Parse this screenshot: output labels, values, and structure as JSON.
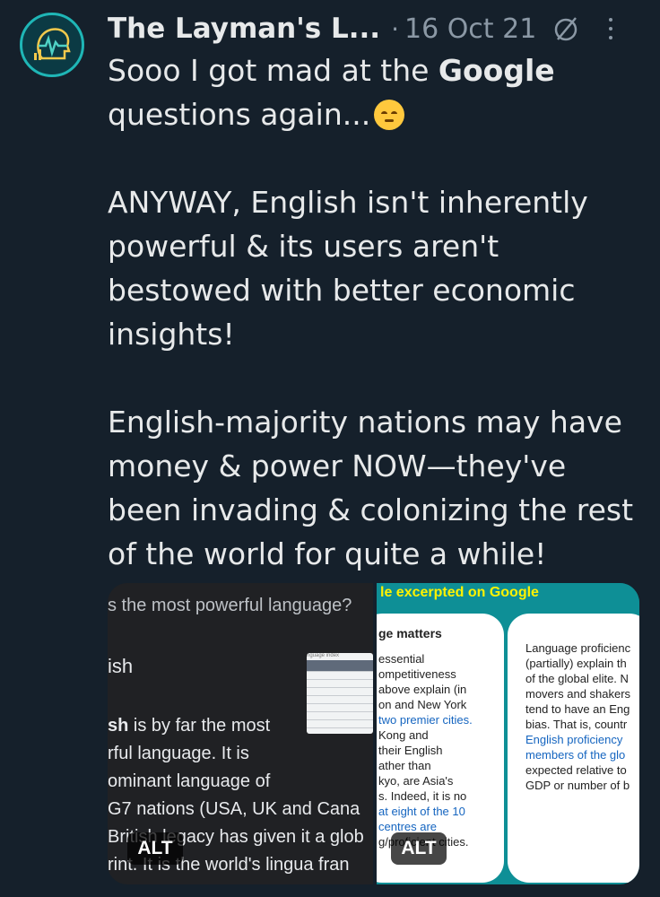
{
  "tweet": {
    "display_name": "The Layman's L...",
    "separator": "·",
    "date": "16 Oct 21",
    "lines_p1": [
      "Sooo I got mad at the "
    ],
    "bold_word": "Google",
    "line_p1b": "questions again...",
    "para2": [
      "ANYWAY, English isn't inherently",
      "powerful & its users aren't",
      "bestowed with better economic",
      "insights!"
    ],
    "para3": [
      "English-majority nations may have",
      "money & power NOW—they've",
      "been invading & colonizing the rest",
      "of the world for quite a while!"
    ]
  },
  "media": {
    "img1": {
      "question": "s the most powerful language?",
      "answer": "ish",
      "thumb_title": "nguage index",
      "bold_start": "sh",
      "line1_rest": " is by far the most",
      "lines": [
        "rful language. It is",
        "ominant language of",
        " G7 nations (USA, UK and Cana",
        "British legacy has given it a glob",
        "rint. It is the world's lingua fran"
      ],
      "alt": "ALT"
    },
    "img2": {
      "banner": "le excerpted on Google",
      "card1_head": "ge matters",
      "card1_lines": [
        "essential",
        "ompetitiveness",
        "above explain (in",
        "on and New York",
        "two premier cities.",
        " Kong and",
        " their English",
        "ather than",
        "kyo, are Asia's",
        "s. Indeed, it is no",
        "at eight of the 10",
        "centres are",
        "g/proficient cities."
      ],
      "card2_lines": [
        "Language proficienc",
        "(partially) explain th",
        "of the global elite. N",
        "movers and shakers",
        "tend to have an Eng",
        "bias. That is, countr",
        "English proficiency",
        "members of the glo",
        "expected relative to",
        "GDP or number of b"
      ],
      "alt": "ALT"
    }
  },
  "icons": {
    "avatar": "brain-waveform-icon",
    "edited": "edited-icon",
    "more": "more-icon"
  }
}
